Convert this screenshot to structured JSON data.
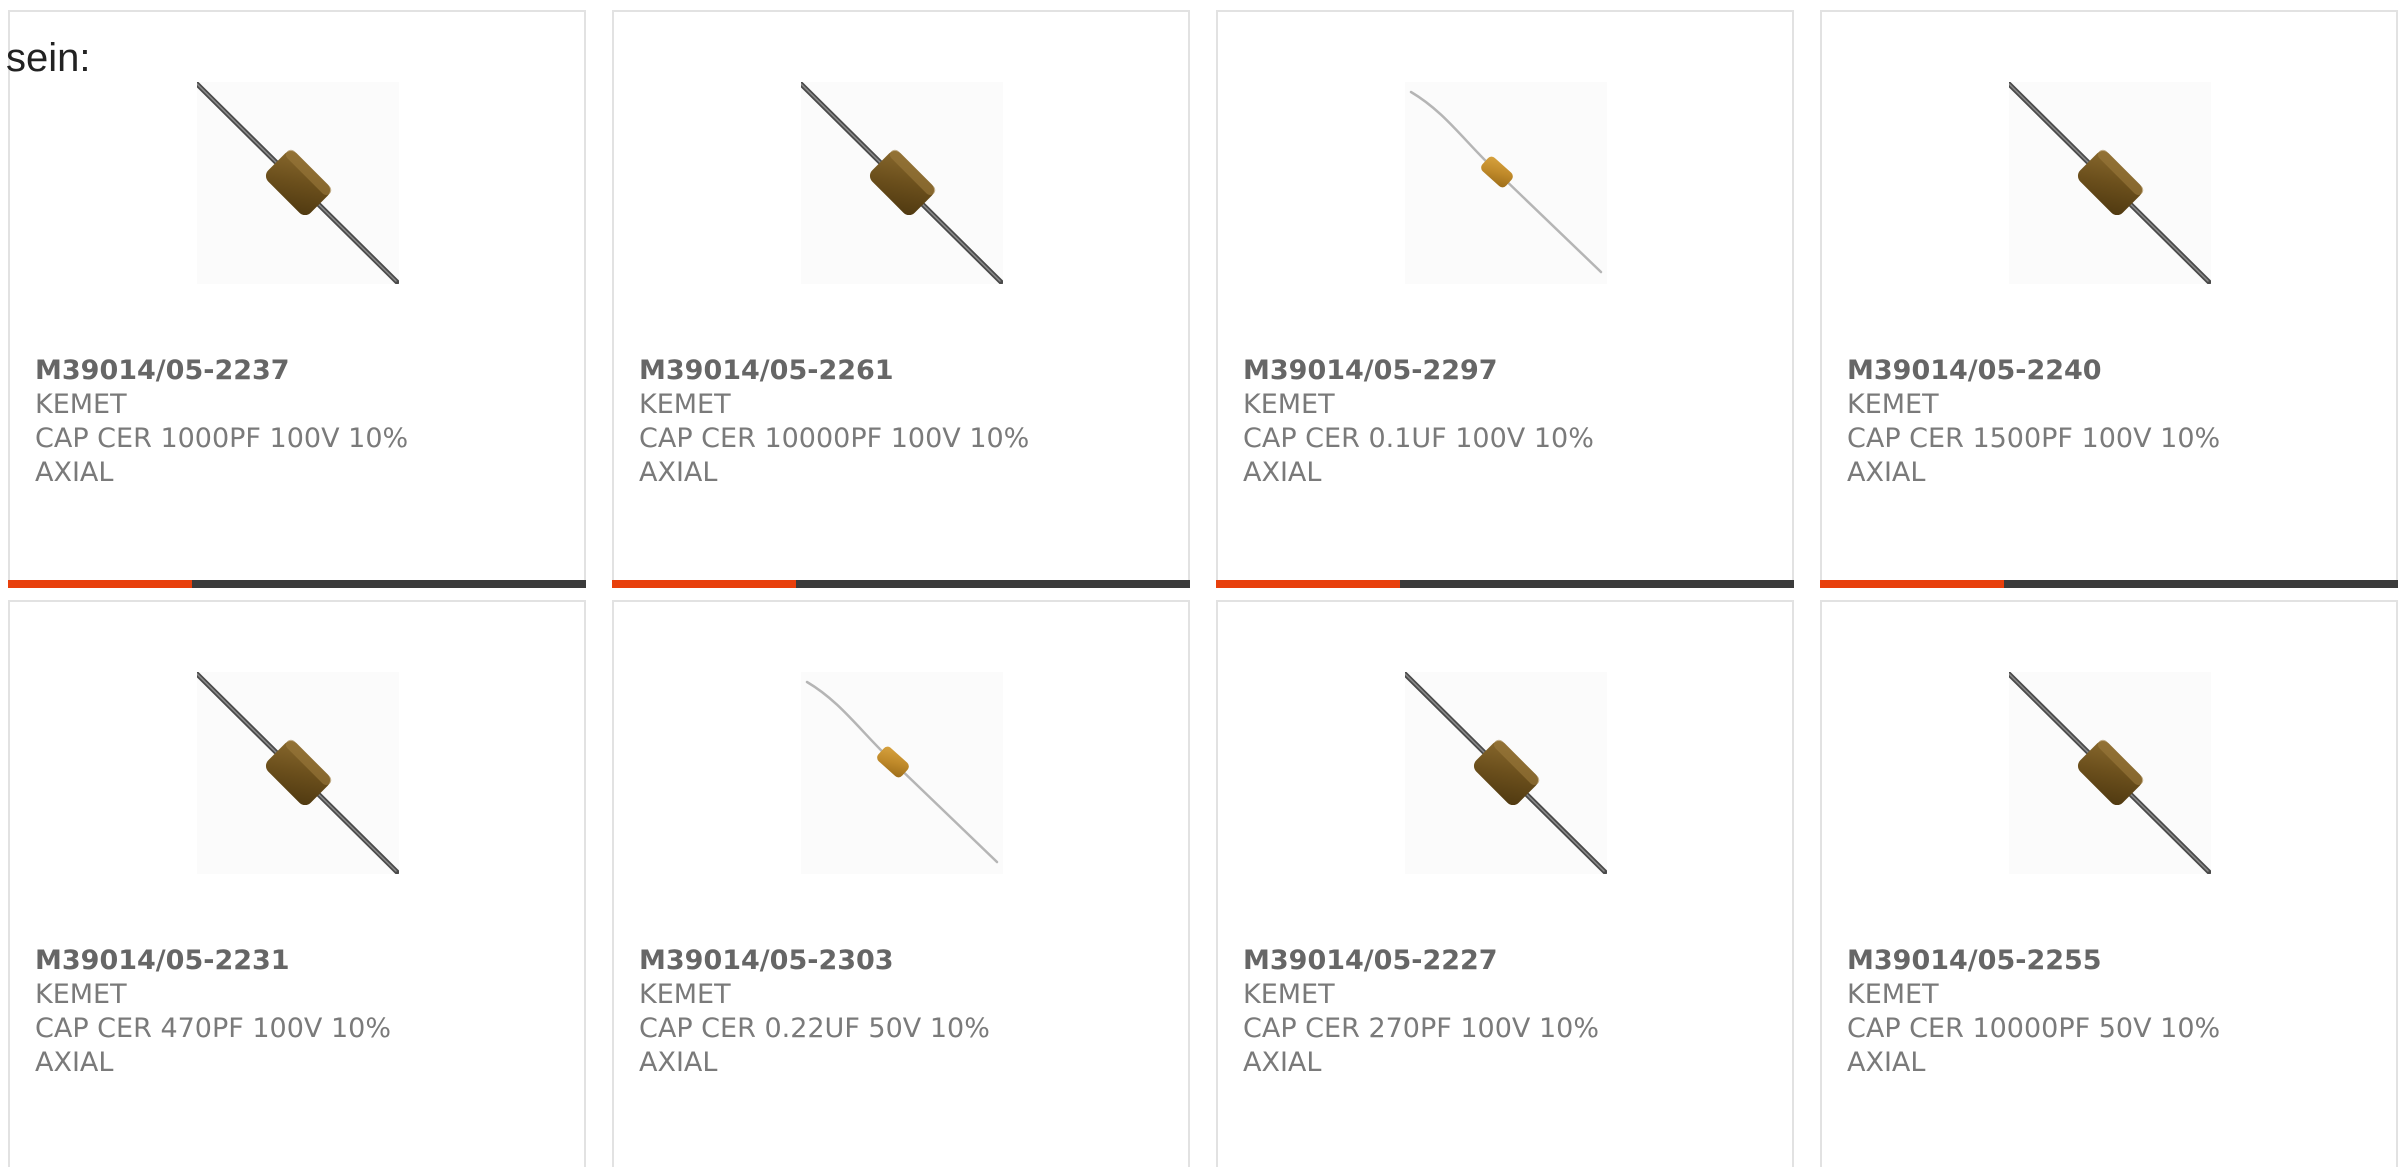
{
  "lead_text": "sein:",
  "colors": {
    "accent": "#e8400c",
    "bar": "#3b3b3b",
    "border": "#e2e2e2",
    "part_number": "#666666",
    "text": "#7a7a7a"
  },
  "products": [
    {
      "part_number": "M39014/05-2237",
      "manufacturer": "KEMET",
      "description": "CAP CER 1000PF 100V 10% AXIAL",
      "image_icon": "axial-capacitor-thick-icon"
    },
    {
      "part_number": "M39014/05-2261",
      "manufacturer": "KEMET",
      "description": "CAP CER 10000PF 100V 10% AXIAL",
      "image_icon": "axial-capacitor-thick-icon"
    },
    {
      "part_number": "M39014/05-2297",
      "manufacturer": "KEMET",
      "description": "CAP CER 0.1UF 100V 10% AXIAL",
      "image_icon": "axial-capacitor-thin-icon"
    },
    {
      "part_number": "M39014/05-2240",
      "manufacturer": "KEMET",
      "description": "CAP CER 1500PF 100V 10% AXIAL",
      "image_icon": "axial-capacitor-thick-icon"
    },
    {
      "part_number": "M39014/05-2231",
      "manufacturer": "KEMET",
      "description": "CAP CER 470PF 100V 10% AXIAL",
      "image_icon": "axial-capacitor-thick-icon"
    },
    {
      "part_number": "M39014/05-2303",
      "manufacturer": "KEMET",
      "description": "CAP CER 0.22UF 50V 10% AXIAL",
      "image_icon": "axial-capacitor-thin-icon"
    },
    {
      "part_number": "M39014/05-2227",
      "manufacturer": "KEMET",
      "description": "CAP CER 270PF 100V 10% AXIAL",
      "image_icon": "axial-capacitor-thick-icon"
    },
    {
      "part_number": "M39014/05-2255",
      "manufacturer": "KEMET",
      "description": "CAP CER 10000PF 50V 10% AXIAL",
      "image_icon": "axial-capacitor-thick-icon"
    }
  ]
}
